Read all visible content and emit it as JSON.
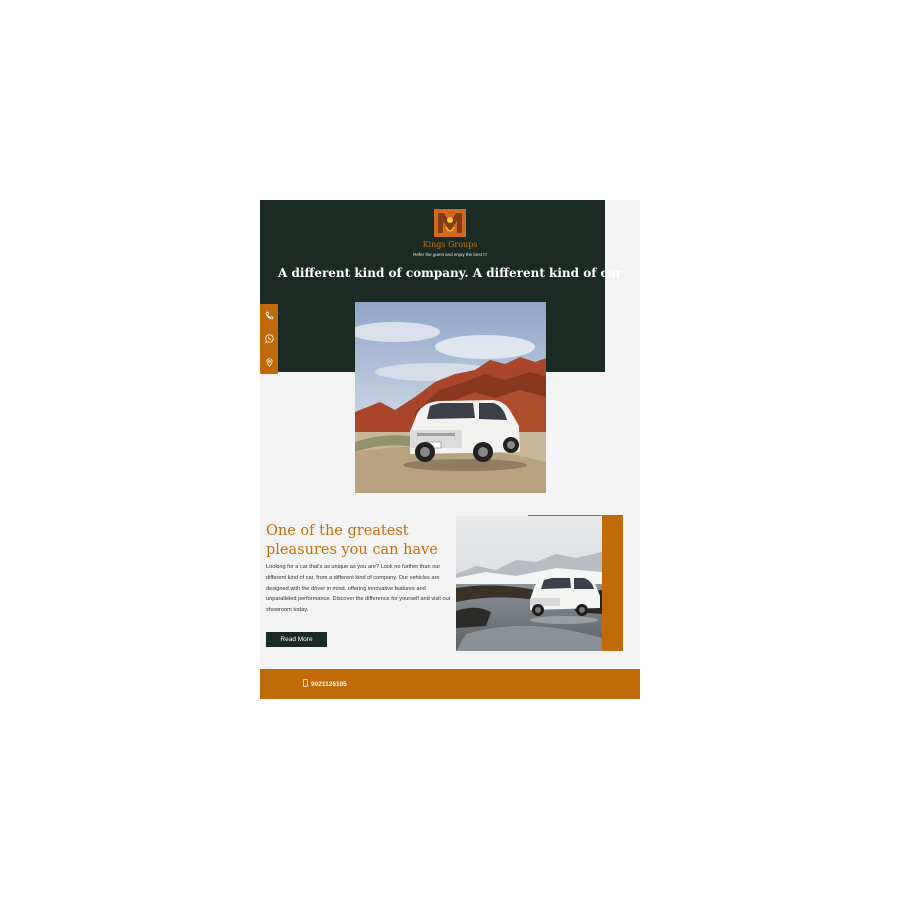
{
  "brand": {
    "name": "Kings Groups",
    "tagline": "Refer the guest and enjoy the best !!!",
    "logo_icon": "logo-emblem"
  },
  "hero": {
    "headline": "A different kind of company. A different kind of car"
  },
  "contact_strip": {
    "icons": [
      "phone-icon",
      "whatsapp-icon",
      "location-icon"
    ]
  },
  "feature": {
    "title": "One of the greatest pleasures you can have",
    "body": "Looking for a car that's as unique as you are? Look no further than our different kind of car, from a different kind of company. Our vehicles are designed with the driver in mind, offering innovative features and unparalleled performance. Discover the difference for yourself and visit our showroom today.",
    "button_label": "Read More"
  },
  "footer": {
    "phone": "9021126105",
    "phone_icon": "mobile-phone-icon"
  },
  "colors": {
    "dark_green": "#1b2a22",
    "accent_orange": "#c06a0a",
    "heading_orange": "#c2700e",
    "panel_bg": "#f3f3f3"
  }
}
